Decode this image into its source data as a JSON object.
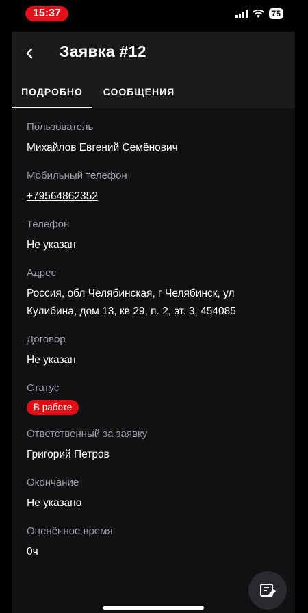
{
  "status_bar": {
    "time": "15:37",
    "battery": "75"
  },
  "header": {
    "title": "Заявка #12",
    "back_icon": "chevron-left-icon"
  },
  "tabs": [
    {
      "label": "ПОДРОБНО",
      "active": true
    },
    {
      "label": "СООБЩЕНИЯ",
      "active": false
    }
  ],
  "details": {
    "user": {
      "label": "Пользователь",
      "value": "Михайлов Евгений Семёнович"
    },
    "mobile": {
      "label": "Мобильный телефон",
      "value": "+79564862352"
    },
    "phone": {
      "label": "Телефон",
      "value": "Не указан"
    },
    "address": {
      "label": "Адрес",
      "value": "Россия, обл Челябинская, г Челябинск, ул Кулибина, дом 13, кв 29, п. 2, эт. 3, 454085"
    },
    "contract": {
      "label": "Договор",
      "value": "Не указан"
    },
    "status": {
      "label": "Статус",
      "value": "В работе",
      "color": "#e20c13"
    },
    "responsible": {
      "label": "Ответственный за заявку",
      "value": "Григорий Петров"
    },
    "end": {
      "label": "Окончание",
      "value": "Не указано"
    },
    "estimated": {
      "label": "Оценённое время",
      "value": "0ч"
    }
  },
  "fab": {
    "icon": "edit-note-icon"
  },
  "colors": {
    "accent": "#e20c13",
    "background": "#000000",
    "panel": "#111113",
    "label": "#9c9ca3"
  }
}
